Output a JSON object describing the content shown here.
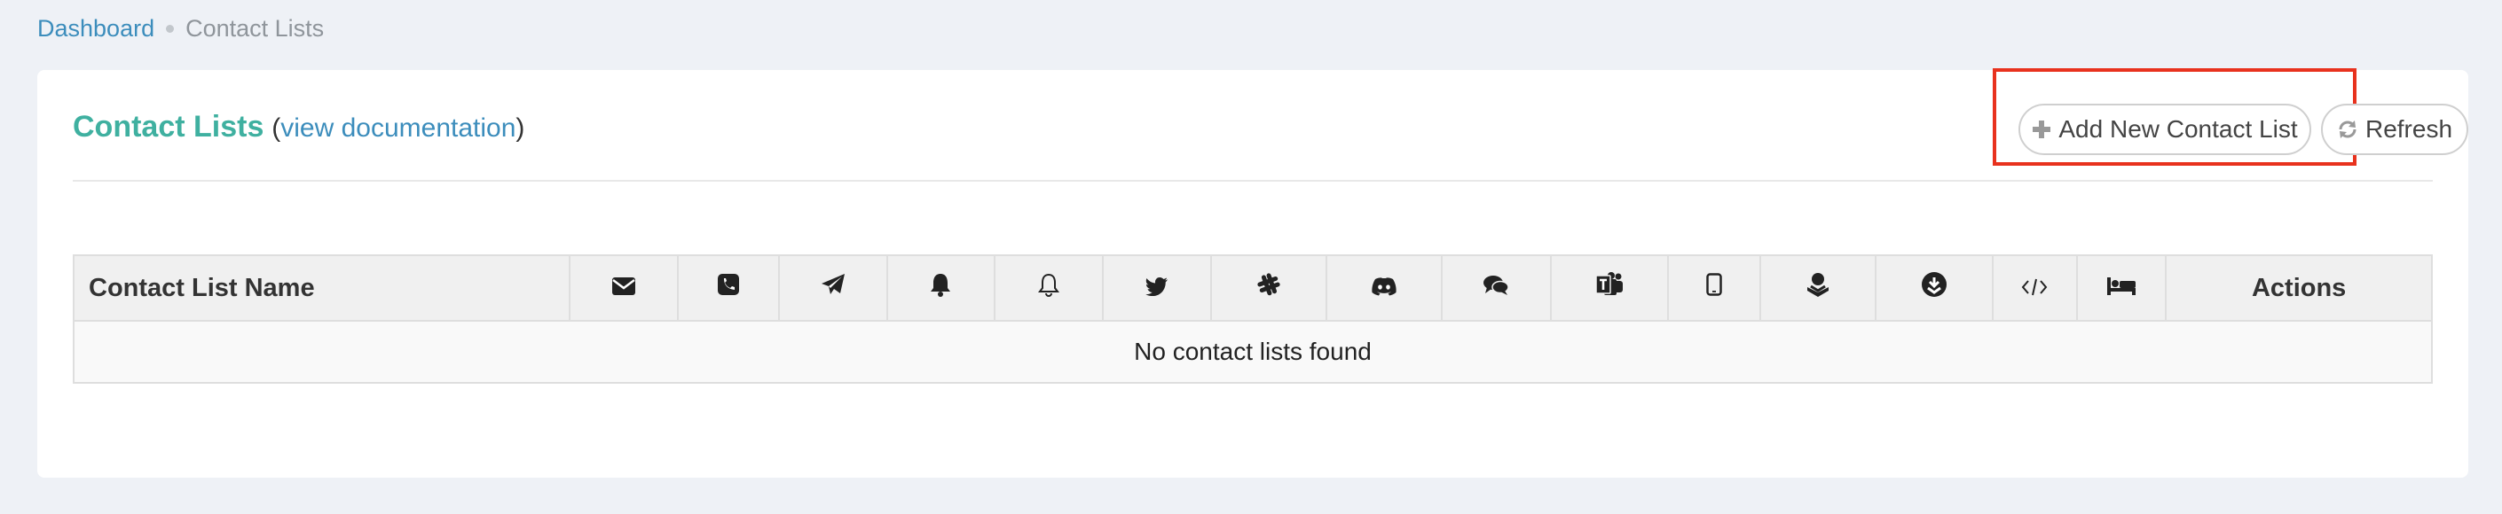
{
  "breadcrumb": {
    "home": "Dashboard",
    "current": "Contact Lists"
  },
  "panel": {
    "title": "Contact Lists",
    "paren_open": "(",
    "doc_link": "view documentation",
    "paren_close": ")"
  },
  "buttons": {
    "add_label": "Add New Contact List",
    "add_icon": "plus-icon",
    "refresh_label": "Refresh",
    "refresh_icon": "refresh-icon"
  },
  "table": {
    "name_header": "Contact List Name",
    "icon_columns": [
      "email-icon",
      "phone-icon",
      "telegram-icon",
      "bell-icon",
      "bell-outline-icon",
      "twitter-icon",
      "slack-icon",
      "discord-icon",
      "chat-bubbles-icon",
      "teams-icon",
      "tablet-icon",
      "pagerduty-icon",
      "opsgenie-icon",
      "webhook-icon",
      "bed-icon"
    ],
    "actions_header": "Actions",
    "empty_message": "No contact lists found"
  },
  "colors": {
    "accent_title": "#3fb0a0",
    "link": "#3c8dbc",
    "highlight": "#e8321e",
    "background": "#eef1f6"
  }
}
